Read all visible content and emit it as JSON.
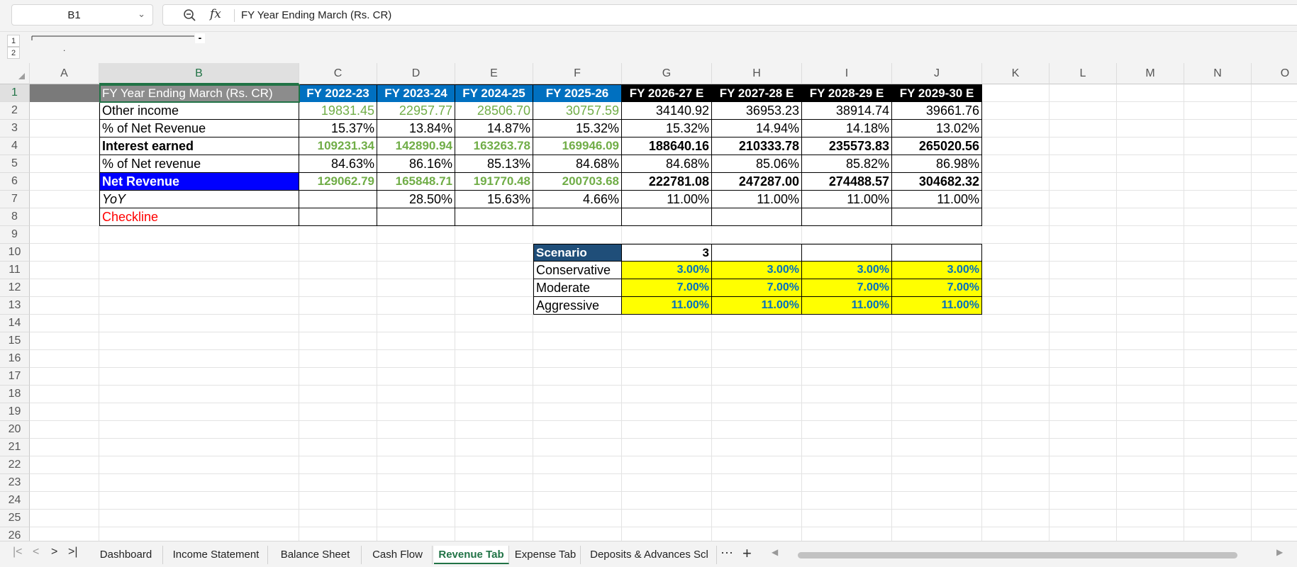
{
  "namebox": {
    "value": "B1"
  },
  "formula_bar": {
    "value": "FY Year Ending March (Rs. CR)"
  },
  "outline": {
    "levels": [
      "1",
      "2"
    ],
    "collapse": "-",
    "dot": "."
  },
  "columns": [
    "A",
    "B",
    "C",
    "D",
    "E",
    "F",
    "G",
    "H",
    "I",
    "J",
    "K",
    "L",
    "M",
    "N",
    "O"
  ],
  "rows": [
    "1",
    "2",
    "3",
    "4",
    "5",
    "6",
    "7",
    "8",
    "9",
    "10",
    "11",
    "12",
    "13",
    "14",
    "15",
    "16",
    "17",
    "18",
    "19",
    "20",
    "21",
    "22",
    "23",
    "24",
    "25",
    "26"
  ],
  "sheet": {
    "header": {
      "label": "FY Year Ending March (Rs. CR)",
      "years": [
        "FY 2022-23",
        "FY 2023-24",
        "FY 2024-25",
        "FY 2025-26",
        "FY 2026-27 E",
        "FY 2027-28 E",
        "FY 2028-29 E",
        "FY 2029-30 E"
      ]
    },
    "rows": [
      {
        "label": "Other income",
        "values": [
          "19831.45",
          "22957.77",
          "28506.70",
          "30757.59",
          "34140.92",
          "36953.23",
          "38914.74",
          "39661.76"
        ]
      },
      {
        "label": "% of Net Revenue",
        "values": [
          "15.37%",
          "13.84%",
          "14.87%",
          "15.32%",
          "15.32%",
          "14.94%",
          "14.18%",
          "13.02%"
        ]
      },
      {
        "label": "Interest earned",
        "values": [
          "109231.34",
          "142890.94",
          "163263.78",
          "169946.09",
          "188640.16",
          "210333.78",
          "235573.83",
          "265020.56"
        ]
      },
      {
        "label": "% of Net revenue",
        "values": [
          "84.63%",
          "86.16%",
          "85.13%",
          "84.68%",
          "84.68%",
          "85.06%",
          "85.82%",
          "86.98%"
        ]
      },
      {
        "label": "Net Revenue",
        "values": [
          "129062.79",
          "165848.71",
          "191770.48",
          "200703.68",
          "222781.08",
          "247287.00",
          "274488.57",
          "304682.32"
        ]
      },
      {
        "label": "YoY",
        "values": [
          "",
          "28.50%",
          "15.63%",
          "4.66%",
          "11.00%",
          "11.00%",
          "11.00%",
          "11.00%"
        ]
      },
      {
        "label": "Checkline",
        "values": [
          "",
          "",
          "",
          "",
          "",
          "",
          "",
          ""
        ]
      }
    ],
    "scenario": {
      "label": "Scenario",
      "value": "3",
      "options": [
        {
          "label": "Conservative",
          "values": [
            "3.00%",
            "3.00%",
            "3.00%",
            "3.00%"
          ]
        },
        {
          "label": "Moderate",
          "values": [
            "7.00%",
            "7.00%",
            "7.00%",
            "7.00%"
          ]
        },
        {
          "label": "Aggressive",
          "values": [
            "11.00%",
            "11.00%",
            "11.00%",
            "11.00%"
          ]
        }
      ]
    }
  },
  "tabs": [
    "Dashboard",
    "Income Statement",
    "Balance Sheet",
    "Cash Flow",
    "Revenue Tab",
    "Expense Tab",
    "Deposits & Advances Scl"
  ],
  "active_tab": "Revenue Tab",
  "tab_bar": {
    "more": "⋯",
    "add": "+"
  },
  "colors": {
    "accent_green": "#217346",
    "hist_header": "#0070c0",
    "net_revenue_fill": "#0000ff",
    "highlight_yellow": "#ffff00",
    "scenario_header": "#1f4e79",
    "historical_value": "#70ad47",
    "checkline_red": "#ff0000"
  }
}
